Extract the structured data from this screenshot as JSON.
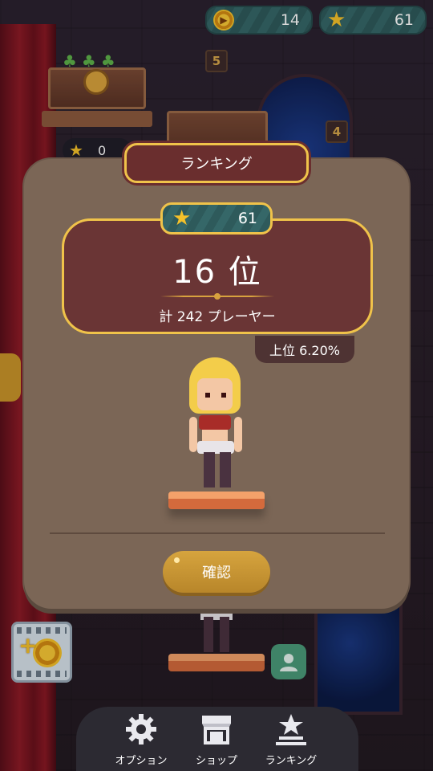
{
  "currency": {
    "coins": "14",
    "stars": "61"
  },
  "scene": {
    "floor_5": "5",
    "floor_4": "4",
    "star_count_bubble": "0"
  },
  "modal": {
    "title": "ランキング",
    "stars": "61",
    "rank": "16 位",
    "total_players": "計 242 プレーヤー",
    "percentile": "上位 6.20%",
    "confirm_label": "確認"
  },
  "nav": {
    "items": [
      {
        "label": "オプション",
        "icon": "gear-icon"
      },
      {
        "label": "ショップ",
        "icon": "shop-icon"
      },
      {
        "label": "ランキング",
        "icon": "ranking-icon"
      }
    ]
  },
  "colors": {
    "accent_gold": "#f0c34a",
    "modal_bg": "#7b6656",
    "panel_bg": "#6a3535",
    "teal_counter": "#2e5a5b"
  }
}
